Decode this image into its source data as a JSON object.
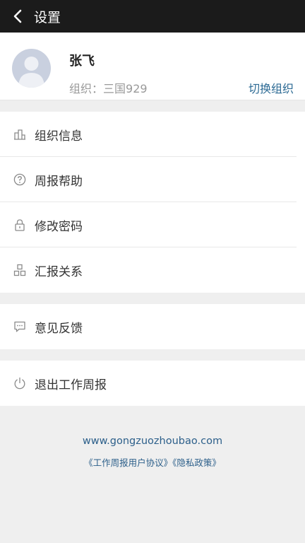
{
  "header": {
    "title": "设置",
    "back_icon": "chevron-left-icon"
  },
  "profile": {
    "name": "张飞",
    "org_label": "组织：",
    "org_name": "三国929",
    "switch_label": "切换组织"
  },
  "menu": {
    "group1": [
      {
        "label": "组织信息",
        "icon": "building-icon"
      },
      {
        "label": "周报帮助",
        "icon": "help-circle-icon"
      },
      {
        "label": "修改密码",
        "icon": "lock-icon"
      },
      {
        "label": "汇报关系",
        "icon": "org-chart-icon"
      }
    ],
    "group2": [
      {
        "label": "意见反馈",
        "icon": "feedback-icon"
      }
    ],
    "group3": [
      {
        "label": "退出工作周报",
        "icon": "power-icon"
      }
    ]
  },
  "footer": {
    "url": "www.gongzuozhoubao.com",
    "agreement": "《工作周报用户协议》",
    "privacy": "《隐私政策》"
  },
  "colors": {
    "topbar": "#1b1b1b",
    "link": "#2c6a94",
    "background": "#efefef"
  }
}
